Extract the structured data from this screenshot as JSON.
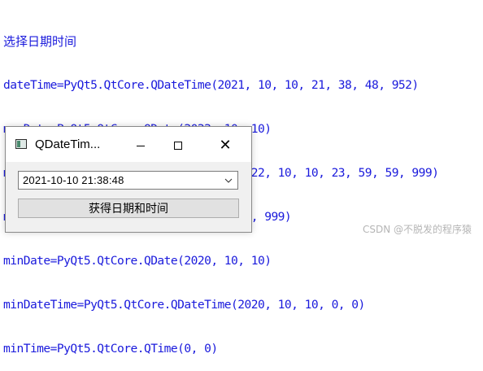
{
  "console": {
    "lines": [
      "选择日期时间",
      "dateTime=PyQt5.QtCore.QDateTime(2021, 10, 10, 21, 38, 48, 952)",
      "maxDate=PyQt5.QtCore.QDate(2022, 10, 10)",
      "maxDateTime=PyQt5.QtCore.QDateTime(2022, 10, 10, 23, 59, 59, 999)",
      "maxTime=PyQt5.QtCore.QTime(23, 59, 59, 999)",
      "minDate=PyQt5.QtCore.QDate(2020, 10, 10)",
      "minDateTime=PyQt5.QtCore.QDateTime(2020, 10, 10, 0, 0)",
      "minTime=PyQt5.QtCore.QTime(0, 0)"
    ],
    "text_color": "#1a1adc"
  },
  "window": {
    "title": "QDateTim...",
    "app_icon": "qt-window-icon",
    "controls": {
      "minimize_icon": "minimize-icon",
      "maximize_icon": "maximize-icon",
      "close_icon": "close-icon",
      "close_glyph": "✕"
    },
    "datetime_combo": {
      "value": "2021-10-10 21:38:48",
      "dropdown_icon": "chevron-down-icon"
    },
    "action_button": {
      "label": "获得日期和时间"
    }
  },
  "watermark": {
    "text": "CSDN @不脱发的程序猿"
  }
}
